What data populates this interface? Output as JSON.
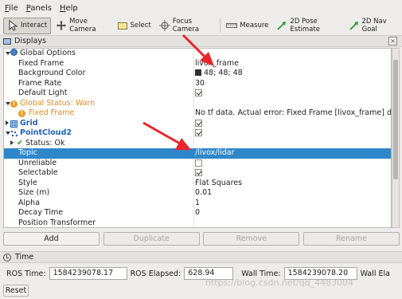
{
  "menu": [
    "File",
    "Panels",
    "Help"
  ],
  "toolbar": {
    "interact": "Interact",
    "move_camera": "Move Camera",
    "select": "Select",
    "focus_camera": "Focus Camera",
    "measure": "Measure",
    "pose_estimate": "2D Pose Estimate",
    "nav_goal": "2D Nav Goal"
  },
  "displays": {
    "title": "Displays",
    "rows": {
      "global_options": "Global Options",
      "fixed_frame": "Fixed Frame",
      "fixed_frame_val": "livox_frame",
      "background_color": "Background Color",
      "background_color_val": "48; 48; 48",
      "frame_rate": "Frame Rate",
      "frame_rate_val": "30",
      "default_light": "Default Light",
      "global_status": "Global Status: Warn",
      "fixed_frame_warn": "Fixed Frame",
      "fixed_frame_warn_val": "No tf data.  Actual error: Fixed Frame [livox_frame] d...",
      "grid": "Grid",
      "pointcloud2": "PointCloud2",
      "status_ok": "Status: Ok",
      "topic": "Topic",
      "topic_val": "/livox/lidar",
      "unreliable": "Unreliable",
      "selectable": "Selectable",
      "style": "Style",
      "style_val": "Flat Squares",
      "size": "Size (m)",
      "size_val": "0.01",
      "alpha": "Alpha",
      "alpha_val": "1",
      "decay_time": "Decay Time",
      "decay_time_val": "0",
      "position_transformer": "Position Transformer"
    }
  },
  "buttons": {
    "add": "Add",
    "duplicate": "Duplicate",
    "remove": "Remove",
    "rename": "Rename"
  },
  "time": {
    "title": "Time",
    "ros_time_label": "ROS Time:",
    "ros_time": "1584239078.17",
    "ros_elapsed_label": "ROS Elapsed:",
    "ros_elapsed": "628.94",
    "wall_time_label": "Wall Time:",
    "wall_time": "1584239078.20",
    "wall_elapsed_label": "Wall Ela",
    "reset": "Reset"
  },
  "watermark": "https://blog.csdn.net/qq_4483004",
  "colors": {
    "selection": "#2f86c9",
    "warning": "#e0891e",
    "arrow": "#e8252a",
    "background_swatch": "#303030"
  }
}
